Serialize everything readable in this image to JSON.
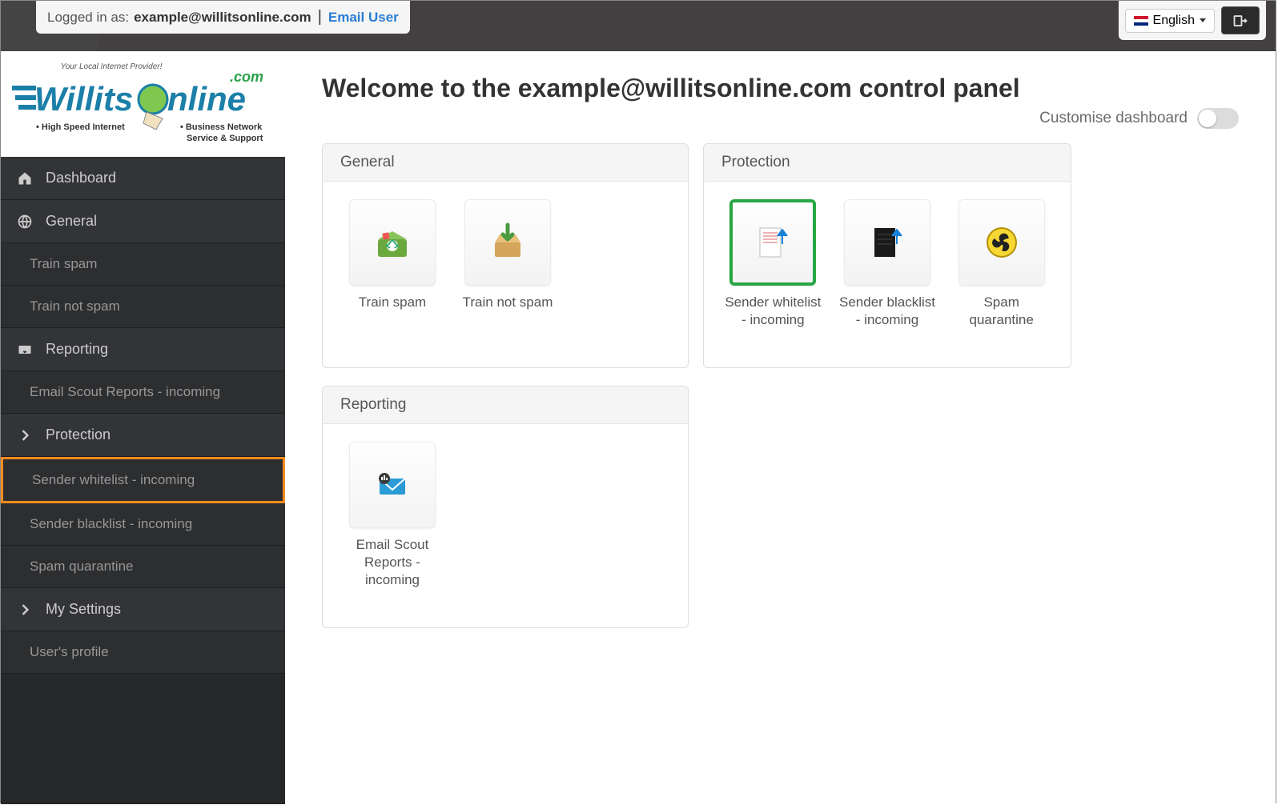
{
  "topbar": {
    "logged_in_prefix": "Logged in as: ",
    "user_email": "example@willitsonline.com",
    "email_user_link": "Email User",
    "language_label": "English"
  },
  "logo": {
    "tagline": "Your Local Internet Provider!",
    "brand_main": "WillitsOnline",
    "brand_tld": ".com",
    "sub1": "• High Speed Internet",
    "sub2": "• Business Network",
    "sub3": "Service & Support"
  },
  "sidebar": {
    "dashboard": "Dashboard",
    "general": "General",
    "general_items": [
      "Train spam",
      "Train not spam"
    ],
    "reporting": "Reporting",
    "reporting_items": [
      "Email Scout Reports - incoming"
    ],
    "protection": "Protection",
    "protection_items": [
      "Sender whitelist - incoming",
      "Sender blacklist - incoming",
      "Spam quarantine"
    ],
    "my_settings": "My Settings",
    "my_settings_items": [
      "User's profile"
    ]
  },
  "main": {
    "title": "Welcome to the example@willitsonline.com control panel",
    "customise_label": "Customise dashboard",
    "panels": {
      "general": {
        "title": "General",
        "tiles": [
          {
            "label": "Train spam",
            "icon": "trash-recycle"
          },
          {
            "label": "Train not spam",
            "icon": "box-download"
          }
        ]
      },
      "protection": {
        "title": "Protection",
        "tiles": [
          {
            "label": "Sender whitelist - incoming",
            "icon": "doc-arrow-up",
            "highlighted": true
          },
          {
            "label": "Sender blacklist - incoming",
            "icon": "doc-black-arrow"
          },
          {
            "label": "Spam quarantine",
            "icon": "biohazard"
          }
        ]
      },
      "reporting": {
        "title": "Reporting",
        "tiles": [
          {
            "label": "Email Scout Reports - incoming",
            "icon": "envelope-stats"
          }
        ]
      }
    }
  }
}
